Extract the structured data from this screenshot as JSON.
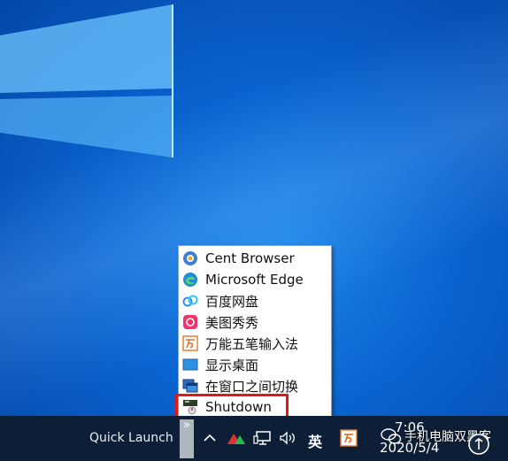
{
  "launch_menu": {
    "items": [
      {
        "label": "Cent Browser",
        "icon": "cent-browser-icon"
      },
      {
        "label": "Microsoft Edge",
        "icon": "edge-icon"
      },
      {
        "label": "百度网盘",
        "icon": "baidu-netdisk-icon"
      },
      {
        "label": "美图秀秀",
        "icon": "meitu-icon"
      },
      {
        "label": "万能五笔输入法",
        "icon": "wanneng-wubi-icon"
      },
      {
        "label": "显示桌面",
        "icon": "show-desktop-icon"
      },
      {
        "label": "在窗口之间切换",
        "icon": "switch-windows-icon"
      },
      {
        "label": "Shutdown",
        "icon": "shutdown-icon"
      }
    ],
    "highlighted_item": "Shutdown",
    "highlight_color": "#e01818"
  },
  "taskbar": {
    "quick_launch_label": "Quick Launch",
    "chevron": "»",
    "tray": {
      "show_hidden_icon": "^",
      "ime_label": "英"
    },
    "clock": {
      "time": "7:06",
      "date": "2020/5/4"
    },
    "watermark": "手机电脑双黑客"
  },
  "colors": {
    "desktop": "#0a63cf",
    "taskbar": "#0d1f37",
    "menu_bg": "#ffffff"
  }
}
